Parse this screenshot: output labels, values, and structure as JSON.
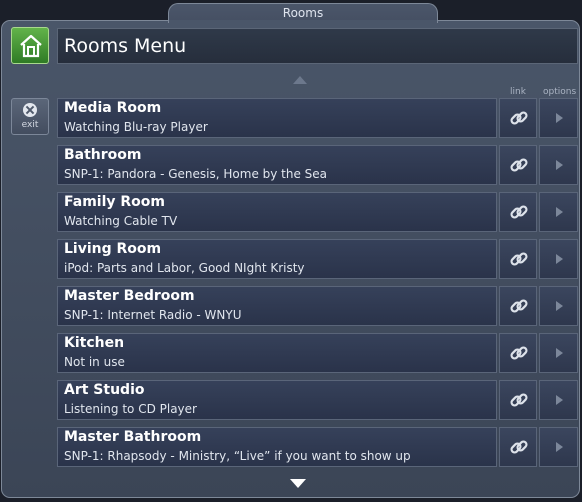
{
  "window": {
    "tab_title": "Rooms"
  },
  "header": {
    "title": "Rooms Menu"
  },
  "columns": {
    "link": "link",
    "options": "options"
  },
  "exit": {
    "label": "exit"
  },
  "rooms": [
    {
      "name": "Media Room",
      "status": "Watching Blu-ray Player"
    },
    {
      "name": "Bathroom",
      "status": "SNP-1: Pandora - Genesis, Home by the Sea"
    },
    {
      "name": "Family Room",
      "status": "Watching Cable TV"
    },
    {
      "name": "Living Room",
      "status": "iPod: Parts and Labor, Good NIght Kristy"
    },
    {
      "name": "Master Bedroom",
      "status": "SNP-1: Internet Radio - WNYU"
    },
    {
      "name": "Kitchen",
      "status": "Not in use"
    },
    {
      "name": "Art Studio",
      "status": "Listening to CD Player"
    },
    {
      "name": "Master Bathroom",
      "status": "SNP-1: Rhapsody - Ministry, “Live” if you want to show up"
    }
  ],
  "colors": {
    "home_green": "#4a9a37",
    "panel": "#434e61",
    "row": "#313b52"
  },
  "icons": {
    "home": "home-icon",
    "exit": "close-circle-icon",
    "link": "chain-link-icon",
    "options": "play-triangle-icon",
    "scroll_up": "arrow-up-icon",
    "scroll_down": "arrow-down-icon"
  }
}
